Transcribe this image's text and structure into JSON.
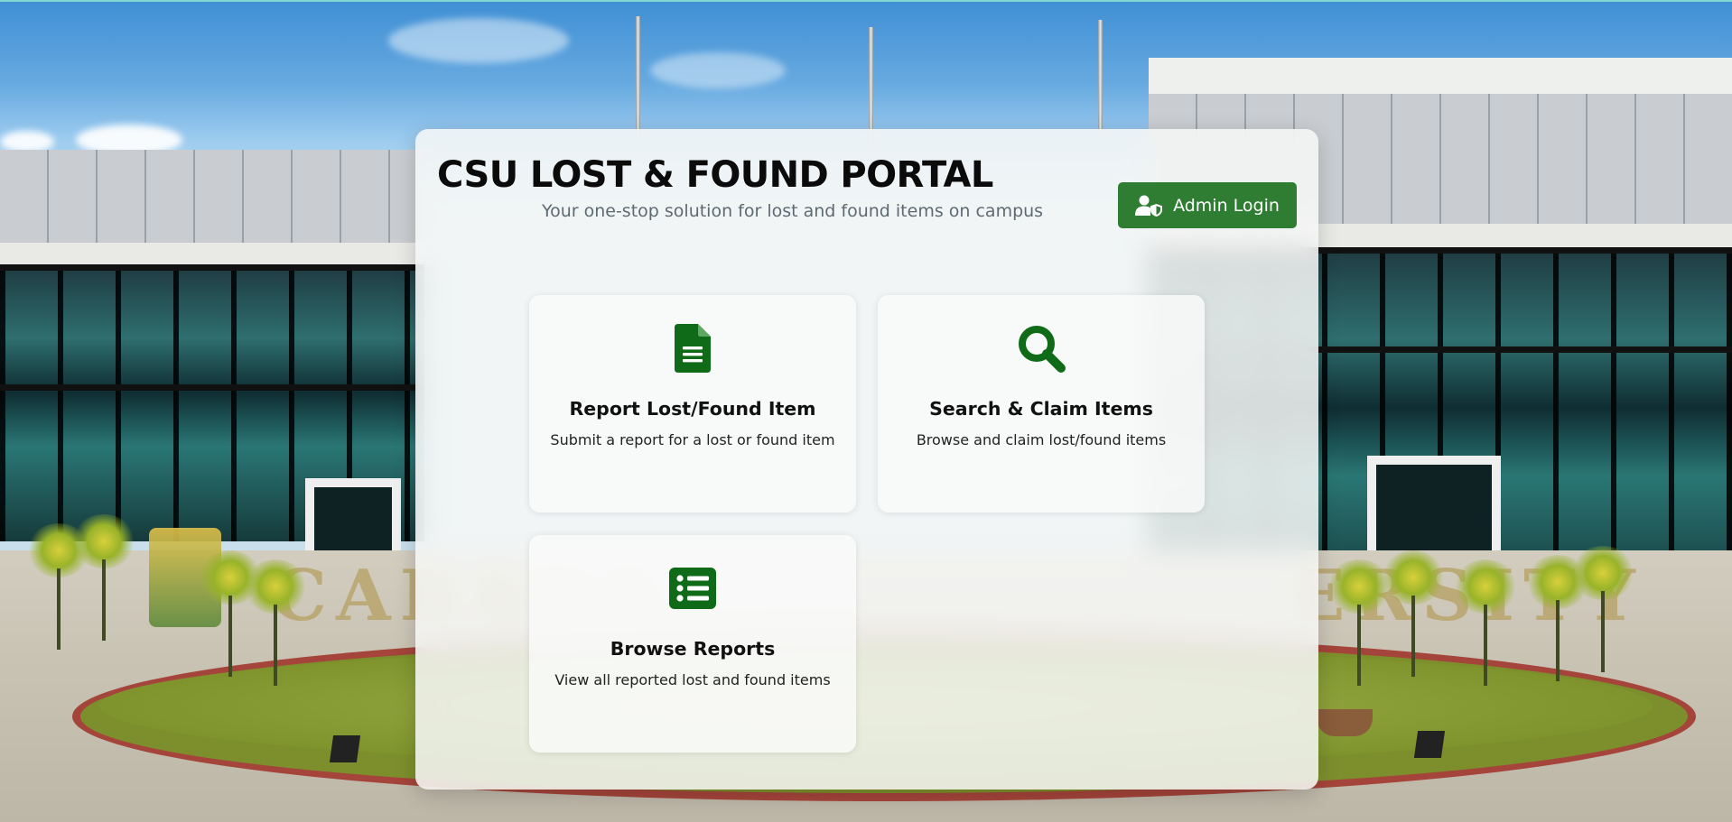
{
  "header": {
    "title": "CSU LOST & FOUND PORTAL",
    "subtitle": "Your one-stop solution for lost and found items on campus"
  },
  "admin_button": {
    "label": "Admin Login",
    "icon": "user-shield-icon"
  },
  "cards": [
    {
      "title": "Report Lost/Found Item",
      "description": "Submit a report for a lost or found item",
      "icon": "file-document-icon"
    },
    {
      "title": "Search & Claim Items",
      "description": "Browse and claim lost/found items",
      "icon": "search-icon"
    },
    {
      "title": "Browse Reports",
      "description": "View all reported lost and found items",
      "icon": "list-icon"
    }
  ],
  "colors": {
    "accent_green": "#2e7d32",
    "icon_green": "#0f6b17"
  }
}
